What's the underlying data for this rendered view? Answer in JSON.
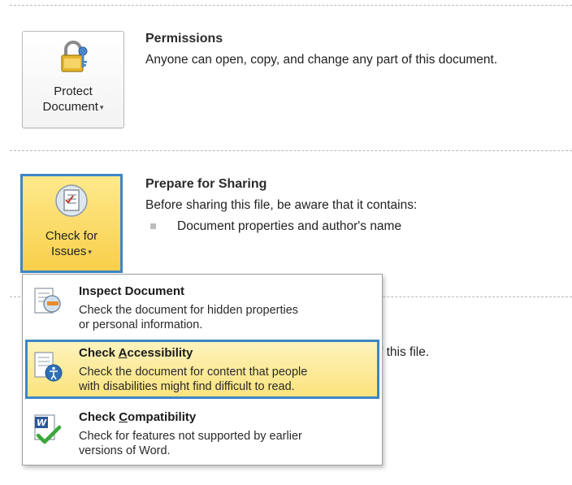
{
  "permissions": {
    "button_label_1": "Protect",
    "button_label_2": "Document",
    "title": "Permissions",
    "description": "Anyone can open, copy, and change any part of this document."
  },
  "sharing": {
    "button_label_1": "Check for",
    "button_label_2": "Issues",
    "title": "Prepare for Sharing",
    "description": "Before sharing this file, be aware that it contains:",
    "bullets": [
      "Document properties and author's name"
    ]
  },
  "partial_text": "f this file.",
  "menu": {
    "items": [
      {
        "title": "Inspect Document",
        "desc_line1": "Check the document for hidden properties",
        "desc_line2": "or personal information.",
        "icon": "inspect-document-icon",
        "highlighted": false
      },
      {
        "title_prefix": "Check ",
        "title_accel": "A",
        "title_suffix": "ccessibility",
        "desc_line1": "Check the document for content that people",
        "desc_line2": "with disabilities might find difficult to read.",
        "icon": "accessibility-icon",
        "highlighted": true
      },
      {
        "title_prefix": "Check ",
        "title_accel": "C",
        "title_suffix": "ompatibility",
        "desc_line1": "Check for features not supported by earlier",
        "desc_line2": "versions of Word.",
        "icon": "word-compatibility-icon",
        "highlighted": false
      }
    ]
  },
  "colors": {
    "accent_blue": "#3d86c6",
    "highlight_yellow": "#fbe37c"
  }
}
